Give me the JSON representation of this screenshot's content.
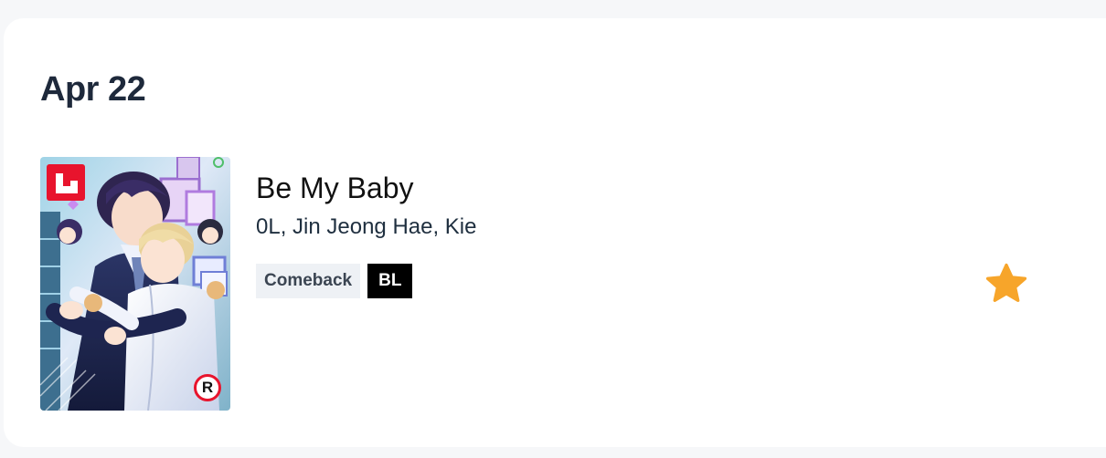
{
  "schedule": {
    "date": "Apr 22"
  },
  "entry": {
    "title": "Be My Baby",
    "authors": "0L, Jin Jeong Hae, Kie",
    "tags": {
      "status": "Comeback",
      "genre": "BL"
    },
    "cover": {
      "publisher_icon": "publisher-logo-icon",
      "rating_badge": "R"
    },
    "favorite": {
      "icon": "star-icon",
      "active": true,
      "color": "#f7a52a"
    }
  },
  "colors": {
    "background": "#f6f7f9",
    "card": "#ffffff",
    "heading": "#1e293b",
    "publisher_red": "#e8142d",
    "star": "#f7a52a"
  }
}
